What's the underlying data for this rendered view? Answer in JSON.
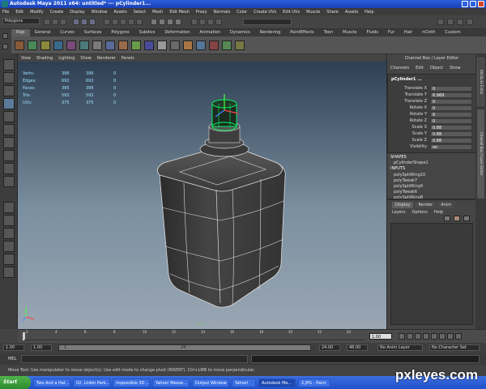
{
  "window": {
    "title": "Autodesk Maya 2011 x64: untitled*   ---   pCylinder1..."
  },
  "menu": [
    "File",
    "Edit",
    "Modify",
    "Create",
    "Display",
    "Window",
    "Assets",
    "Select",
    "Mesh",
    "Edit Mesh",
    "Proxy",
    "Normals",
    "Color",
    "Create UVs",
    "Edit UVs",
    "Muscle",
    "Share",
    "Assets",
    "Help"
  ],
  "statusline": {
    "mode": "Polygons"
  },
  "shelf_tabs": [
    "Rigs",
    "General",
    "Curves",
    "Surfaces",
    "Polygons",
    "Subdivs",
    "Deformation",
    "Animation",
    "Dynamics",
    "Rendering",
    "PaintEffects",
    "Toon",
    "Muscle",
    "Fluids",
    "Fur",
    "Hair",
    "nCloth",
    "Custom"
  ],
  "shelf_active": "Rigs",
  "viewport": {
    "menu": [
      "View",
      "Shading",
      "Lighting",
      "Show",
      "Renderer",
      "Panels"
    ],
    "hud_labels": [
      "Verts:",
      "Edges:",
      "Faces:",
      "Tris:",
      "UVs:"
    ],
    "hud_col1": [
      "396",
      "692",
      "395",
      "592",
      "375"
    ],
    "hud_col2": [
      "396",
      "692",
      "396",
      "592",
      "375"
    ],
    "hud_col3": [
      "0",
      "0",
      "0",
      "0",
      "0"
    ],
    "camera_label": "persp"
  },
  "channel_box": {
    "header": "Channel Box / Layer Editor",
    "menu": [
      "Channels",
      "Edit",
      "Object",
      "Show"
    ],
    "object_name": "pCylinder1 ...",
    "channels": [
      {
        "label": "Translate X",
        "value": "0"
      },
      {
        "label": "Translate Y",
        "value": "6.969"
      },
      {
        "label": "Translate Z",
        "value": "0"
      },
      {
        "label": "Rotate X",
        "value": "0"
      },
      {
        "label": "Rotate Y",
        "value": "0"
      },
      {
        "label": "Rotate Z",
        "value": "0"
      },
      {
        "label": "Scale X",
        "value": "0.88"
      },
      {
        "label": "Scale Y",
        "value": "0.88"
      },
      {
        "label": "Scale Z",
        "value": "0.88"
      },
      {
        "label": "Visibility",
        "value": "on"
      }
    ],
    "shapes_header": "SHAPES",
    "shape_name": "pCylinderShape1",
    "inputs_header": "INPUTS",
    "inputs": [
      "polySplitRing10",
      "polyTweak7",
      "polySplitRing9",
      "polyTweak6",
      "polySplitRing8"
    ]
  },
  "layer_editor": {
    "tabs": [
      "Display",
      "Render",
      "Anim"
    ],
    "menu": [
      "Layers",
      "Options",
      "Help"
    ]
  },
  "side_tabs": [
    "Attribute Editor",
    "Channel Box / Layer Editor"
  ],
  "timeline": {
    "ticks": [
      "2",
      "4",
      "6",
      "8",
      "10",
      "12",
      "14",
      "16",
      "18",
      "20",
      "22",
      "24"
    ],
    "current_frame": "1.00"
  },
  "range": {
    "start": "1.00",
    "play_start": "1.00",
    "slider_start": "1",
    "slider_end": "24",
    "play_end": "24.00",
    "end": "48.00",
    "anim_layer": "No Anim Layer",
    "character_set": "No Character Set"
  },
  "cmdline": {
    "label": "MEL"
  },
  "helpline": {
    "text": "Move Tool: Use manipulator to move object(s). Use edit mode to change pivot (INSERT). Ctrl+LMB to move perpendicular."
  },
  "taskbar": {
    "start": "Start",
    "items": [
      "Two And a Hal...",
      "02. Linkin Park...",
      "Impossible 3D ...",
      "Yahoo! Messe...",
      "Output Window",
      "Yahoo!",
      "Autodesk Ma...",
      "2.JPG - Paint"
    ]
  },
  "watermark": "pxleyes.com",
  "colors": {
    "titlebar": "#1b3fb5",
    "viewport_top": "#2e3f53",
    "viewport_bottom": "#9aa6b3",
    "selection": "#00ff66",
    "taskbar": "#245edb"
  }
}
